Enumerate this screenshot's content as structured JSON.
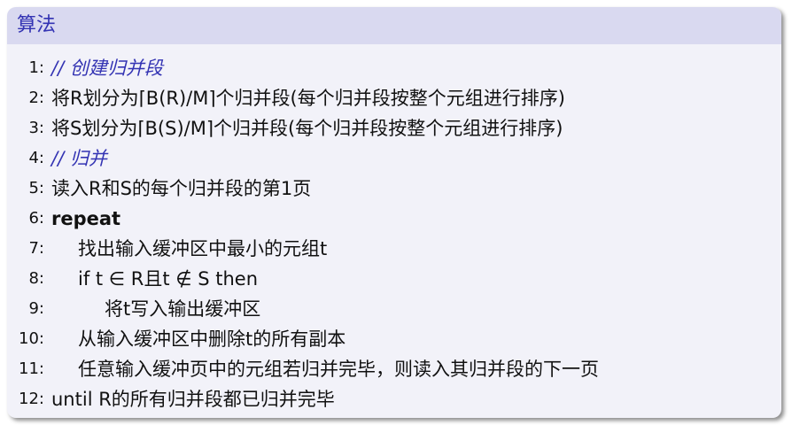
{
  "block": {
    "title": "算法"
  },
  "lines": [
    {
      "num": "1:",
      "text": "// 创建归并段"
    },
    {
      "num": "2:",
      "text": "将R划分为⌈B(R)/M⌉个归并段(每个归并段按整个元组进行排序)"
    },
    {
      "num": "3:",
      "text": "将S划分为⌈B(S)/M⌉个归并段(每个归并段按整个元组进行排序)"
    },
    {
      "num": "4:",
      "text": "// 归并"
    },
    {
      "num": "5:",
      "text": "读入R和S的每个归并段的第1页"
    },
    {
      "num": "6:",
      "text": "repeat"
    },
    {
      "num": "7:",
      "text": "找出输入缓冲区中最小的元组t"
    },
    {
      "num": "8:",
      "text": "if t ∈ R且t ∉ S then"
    },
    {
      "num": "9:",
      "text": "将t写入输出缓冲区"
    },
    {
      "num": "10:",
      "text": "从输入缓冲区中删除t的所有副本"
    },
    {
      "num": "11:",
      "text": "任意输入缓冲页中的元组若归并完毕，则读入其归并段的下一页"
    },
    {
      "num": "12:",
      "text": "until R的所有归并段都已归并完毕"
    }
  ],
  "colors": {
    "title_bar": "#d9d9f0",
    "title_text": "#3333b3",
    "body_bg": "#f2f2f9",
    "comment": "#3333b3"
  }
}
